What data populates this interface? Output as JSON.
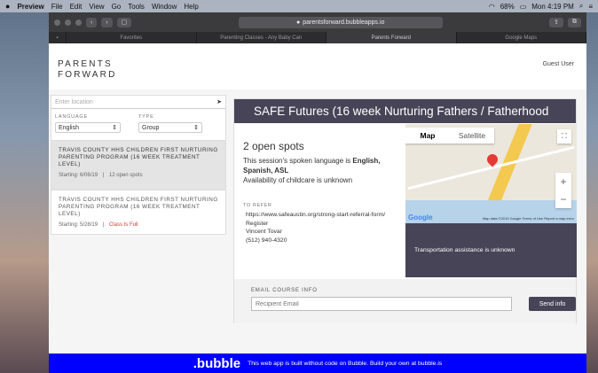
{
  "menubar": {
    "app": "Preview",
    "items": [
      "File",
      "Edit",
      "View",
      "Go",
      "Tools",
      "Window",
      "Help"
    ],
    "battery": "68%",
    "clock": "Mon 4:19 PM"
  },
  "browser": {
    "url": "parentsforward.bubbleapps.io",
    "tabs": [
      "Favorites",
      "Parenting Classes - Any Baby Can",
      "Parents Forward",
      "Google Maps"
    ]
  },
  "header": {
    "logo_line1": "PARENTS",
    "logo_line2": "FORWARD",
    "user": "Guest User"
  },
  "search": {
    "location_placeholder": "Enter location",
    "language_label": "LANGUAGE",
    "language_value": "English",
    "type_label": "TYPE",
    "type_value": "Group"
  },
  "results": [
    {
      "title": "TRAVIS COUNTY HHS CHILDREN FIRST NURTURING PARENTING PROGRAM  (16 WEEK TREATMENT LEVEL)",
      "starting": "Starting: 6/06/19",
      "sep": "|",
      "status": "12 open spots"
    },
    {
      "title": "TRAVIS COUNTY HHS CHILDREN FIRST NURTURING PARENTING PROGRAM  (16 WEEK TREATMENT LEVEL)",
      "starting": "Starting: 5/28/19",
      "sep": "|",
      "status": "Class Is Full"
    }
  ],
  "detail": {
    "title": "SAFE Futures (16 week Nurturing Fathers / Fatherhood",
    "spots": "2 open spots",
    "language_prefix": "This session's spoken language is ",
    "language_value": "English, Spanish, ASL",
    "childcare": "Availability of childcare is unknown",
    "refer_label": "TO REFER",
    "refer_url": "https://www.safeaustin.org/strong-start-referral-form/",
    "register": "Register",
    "contact_name": "Vincent Tovar",
    "contact_phone": "(512) 940-4320",
    "transport": "Transportation assistance is unknown"
  },
  "map": {
    "tab_map": "Map",
    "tab_satellite": "Satellite",
    "zoom_in": "+",
    "zoom_out": "−",
    "google": "Google",
    "credits": "Map data ©2019 Google   Terms of Use   Report a map error"
  },
  "email": {
    "label": "EMAIL COURSE INFO",
    "placeholder": "Recipient Email",
    "button": "Send info"
  },
  "footer": {
    "brand": ".bubble",
    "text": "This web app is built without code on Bubble. Build your own at bubble.is"
  }
}
